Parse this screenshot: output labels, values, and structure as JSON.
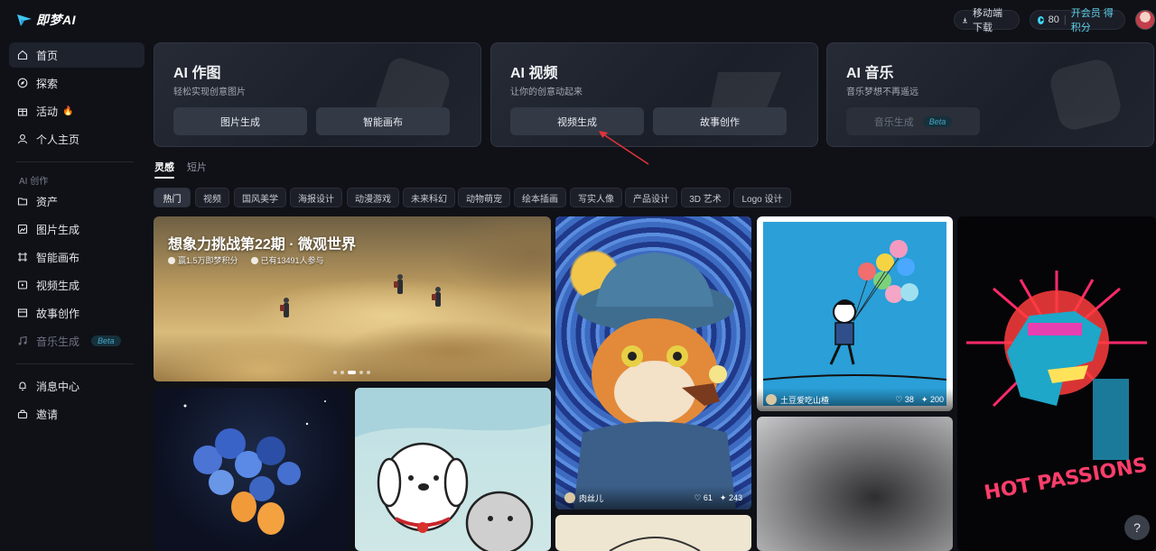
{
  "app": {
    "name": "即梦AI"
  },
  "topbar": {
    "download_label": "移动端下载",
    "credits_value": "80",
    "membership_label": "开会员 得积分"
  },
  "sidebar": {
    "items": [
      {
        "label": "首页",
        "icon": "home-icon"
      },
      {
        "label": "探索",
        "icon": "compass-icon"
      },
      {
        "label": "活动",
        "icon": "gift-icon",
        "extra": "🔥"
      },
      {
        "label": "个人主页",
        "icon": "user-icon"
      }
    ],
    "section_label": "AI 创作",
    "create_items": [
      {
        "label": "资产",
        "icon": "folder-icon"
      },
      {
        "label": "图片生成",
        "icon": "image-icon"
      },
      {
        "label": "智能画布",
        "icon": "canvas-icon"
      },
      {
        "label": "视频生成",
        "icon": "video-icon"
      },
      {
        "label": "故事创作",
        "icon": "story-icon"
      },
      {
        "label": "音乐生成",
        "icon": "music-icon",
        "badge": "Beta"
      }
    ],
    "bottom_items": [
      {
        "label": "消息中心",
        "icon": "bell-icon"
      },
      {
        "label": "邀请",
        "icon": "invite-icon"
      }
    ]
  },
  "features": [
    {
      "title": "AI 作图",
      "subtitle": "轻松实现创意图片",
      "buttons": [
        "图片生成",
        "智能画布"
      ]
    },
    {
      "title": "AI 视频",
      "subtitle": "让你的创意动起来",
      "buttons": [
        "视频生成",
        "故事创作"
      ]
    },
    {
      "title": "AI 音乐",
      "subtitle": "音乐梦想不再遥远",
      "buttons": [
        "音乐生成"
      ],
      "badge": "Beta"
    }
  ],
  "feed_tabs": [
    "灵感",
    "短片"
  ],
  "categories": [
    "热门",
    "视频",
    "国风美学",
    "海报设计",
    "动漫游戏",
    "未来科幻",
    "动物萌宠",
    "绘本插画",
    "写实人像",
    "产品设计",
    "3D 艺术",
    "Logo 设计"
  ],
  "banner": {
    "title": "想象力挑战第22期 · 微观世界",
    "reward": "赢1.5万即梦积分",
    "participants": "已有13491人参与"
  },
  "cards": {
    "cat": {
      "author": "肉丝儿",
      "likes": "61",
      "remixes": "243"
    },
    "boy": {
      "author": "土豆爱吃山楂",
      "likes": "38",
      "remixes": "200"
    }
  },
  "help_label": "?"
}
